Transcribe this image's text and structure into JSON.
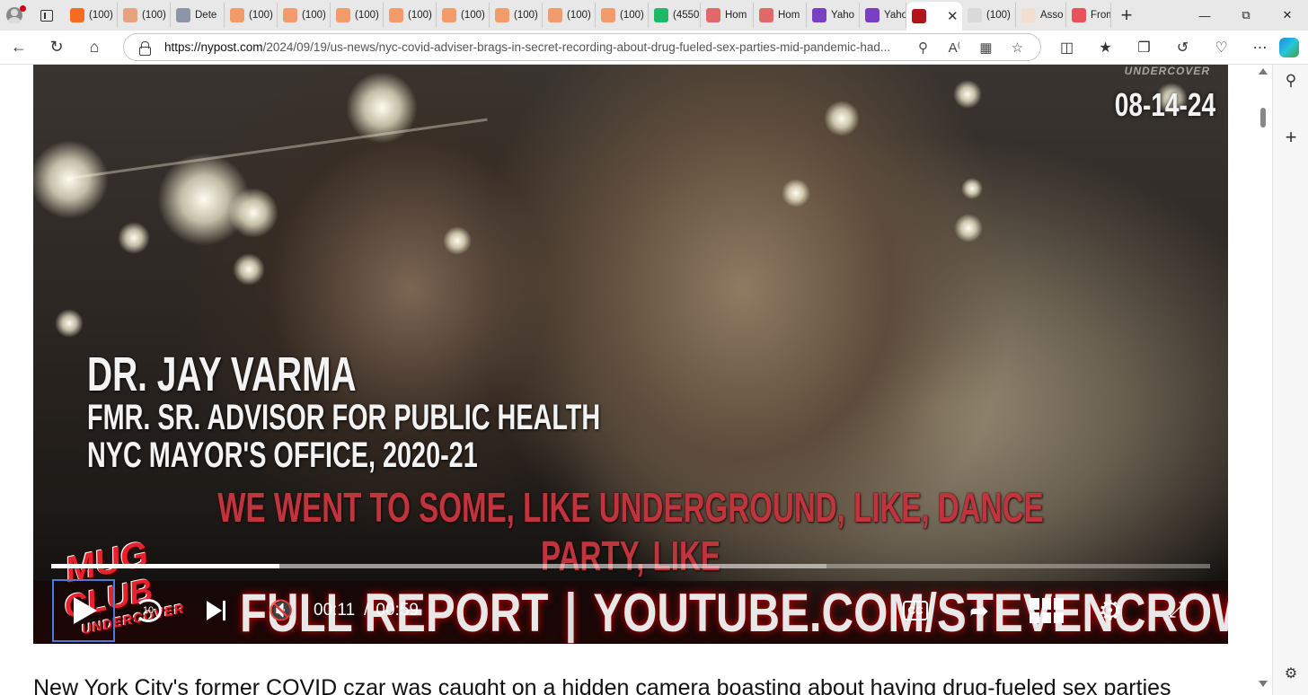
{
  "browser": {
    "tabs": [
      {
        "label": "(100)",
        "color": "#f36c21"
      },
      {
        "label": "(100)",
        "color": "#e8a27f"
      },
      {
        "label": "Dete",
        "color": "#8d96a8"
      },
      {
        "label": "(100)",
        "color": "#f39c6b"
      },
      {
        "label": "(100)",
        "color": "#f39c6b"
      },
      {
        "label": "(100)",
        "color": "#f39c6b"
      },
      {
        "label": "(100)",
        "color": "#f39c6b"
      },
      {
        "label": "(100)",
        "color": "#f39c6b"
      },
      {
        "label": "(100)",
        "color": "#f39c6b"
      },
      {
        "label": "(100)",
        "color": "#f39c6b"
      },
      {
        "label": "(100)",
        "color": "#f39c6b"
      },
      {
        "label": "(4550",
        "color": "#1fb866"
      },
      {
        "label": "Hom",
        "color": "#e06a6a"
      },
      {
        "label": "Hom",
        "color": "#e06a6a"
      },
      {
        "label": "Yaho",
        "color": "#7b3fc4"
      },
      {
        "label": "Yaho",
        "color": "#7b3fc4"
      },
      {
        "label": "",
        "color": "#b3141c",
        "active": true
      },
      {
        "label": "(100)",
        "color": "#d9d9d9"
      },
      {
        "label": "Asso",
        "color": "#f2dfcf"
      },
      {
        "label": "From",
        "color": "#e8525a"
      }
    ],
    "url_domain": "https://nypost.com",
    "url_path": "/2024/09/19/us-news/nyc-covid-adviser-brags-in-secret-recording-about-drug-fueled-sex-parties-mid-pandemic-had..."
  },
  "video": {
    "watermark": "UNDERCOVER",
    "date": "08-14-24",
    "lower_third": {
      "name": "DR. JAY VARMA",
      "line1": "FMR. SR. ADVISOR FOR PUBLIC HEALTH",
      "line2": "NYC MAYOR'S OFFICE, 2020-21"
    },
    "caption": "WE WENT TO SOME, LIKE UNDERGROUND, LIKE, DANCE PARTY, LIKE",
    "logo": {
      "line1": "MUG",
      "line2": "CLUB",
      "line3": "UNDERCOVER"
    },
    "banner_left": "FULL REPORT",
    "banner_sep": "|",
    "banner_right": "YOUTUBE.COM/STEVENCROWDER",
    "player": {
      "current_time": "00:11",
      "separator": "/",
      "duration": "00:59",
      "played_fraction": 0.197,
      "buffered_fraction": 0.669,
      "replay_label": "10",
      "cc_label": "CC"
    }
  },
  "article": {
    "first_line": "New York City's former COVID czar was caught on a hidden camera boasting about having drug-fueled sex parties"
  }
}
